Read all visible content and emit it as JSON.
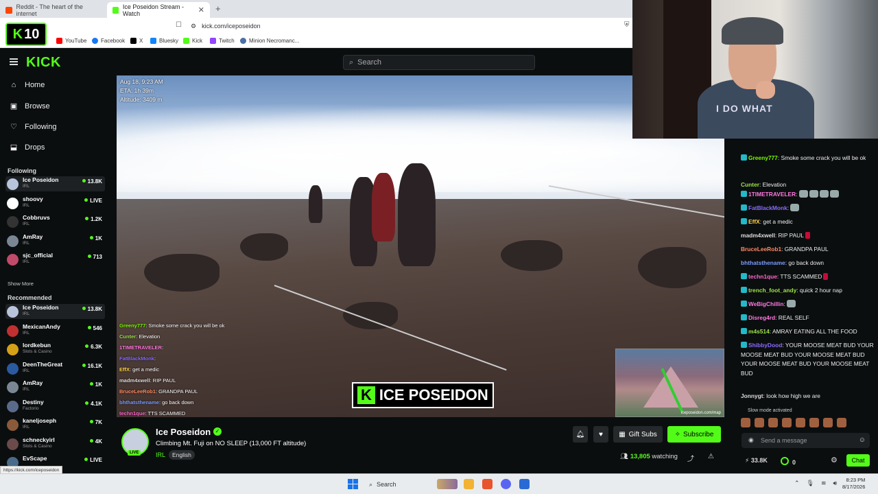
{
  "browser": {
    "tabs": [
      {
        "label": "Reddit - The heart of the internet",
        "color": "#ff4500"
      },
      {
        "label": "Ice Poseidon Stream - Watch",
        "color": "#53fc18"
      }
    ],
    "url": "kick.com/iceposeidon",
    "bookmarks": [
      {
        "label": "YouTube",
        "color": "#ff0000"
      },
      {
        "label": "Facebook",
        "color": "#1877f2"
      },
      {
        "label": "X",
        "color": "#000000"
      },
      {
        "label": "Bluesky",
        "color": "#1185fe"
      },
      {
        "label": "Kick",
        "color": "#53fc18"
      },
      {
        "label": "Twitch",
        "color": "#9146ff"
      },
      {
        "label": "Minion Necromanc...",
        "color": "#4a6fa5"
      }
    ],
    "kick_badge_number": "10",
    "hover_url": "https://kick.com/iceposeidon"
  },
  "kick": {
    "brand": "KICK",
    "search_placeholder": "Search",
    "nav": [
      {
        "label": "Home",
        "icon": "home-icon",
        "glyph": "⌂"
      },
      {
        "label": "Browse",
        "icon": "browse-icon",
        "glyph": "▣"
      },
      {
        "label": "Following",
        "icon": "heart-icon",
        "glyph": "♡"
      },
      {
        "label": "Drops",
        "icon": "drops-icon",
        "glyph": "⬓"
      }
    ],
    "following_title": "Following",
    "following": [
      {
        "name": "Ice Poseidon",
        "cat": "IRL",
        "viewers": "13.8K",
        "color": "#b8c4dc"
      },
      {
        "name": "shoovy",
        "cat": "IRL",
        "viewers": "LIVE",
        "color": "#ffffff"
      },
      {
        "name": "Cobbruvs",
        "cat": "IRL",
        "viewers": "1.2K",
        "color": "#333333"
      },
      {
        "name": "AmRay",
        "cat": "IRL",
        "viewers": "1K",
        "color": "#7a8694"
      },
      {
        "name": "sjc_official",
        "cat": "IRL",
        "viewers": "713",
        "color": "#c04a6a"
      }
    ],
    "show_more": "Show More",
    "recommended_title": "Recommended",
    "recommended": [
      {
        "name": "Ice Poseidon",
        "cat": "IRL",
        "viewers": "13.8K",
        "color": "#b8c4dc"
      },
      {
        "name": "MexicanAndy",
        "cat": "IRL",
        "viewers": "546",
        "color": "#c03030"
      },
      {
        "name": "lordkebun",
        "cat": "Slots & Casino",
        "viewers": "6.3K",
        "color": "#d4a017"
      },
      {
        "name": "DeenTheGreat",
        "cat": "IRL",
        "viewers": "16.1K",
        "color": "#2a5aa0"
      },
      {
        "name": "AmRay",
        "cat": "IRL",
        "viewers": "1K",
        "color": "#7a8694"
      },
      {
        "name": "Destiny",
        "cat": "Factorio",
        "viewers": "4.1K",
        "color": "#5a6a8a"
      },
      {
        "name": "kaneljoseph",
        "cat": "IRL",
        "viewers": "7K",
        "color": "#8a5a3a"
      },
      {
        "name": "schneckyirl",
        "cat": "Slots & Casino",
        "viewers": "4K",
        "color": "#6a4a4a"
      },
      {
        "name": "EvScape",
        "cat": "",
        "viewers": "LIVE",
        "color": "#4a6a8a"
      }
    ]
  },
  "video": {
    "overlay_lines": [
      "Aug 18, 9:23 AM",
      "ETA: 1h 39m",
      "Altitude: 3409 m"
    ],
    "chat_overlay": [
      {
        "user": "Greeny777",
        "color": "#7cfc00",
        "text": " Smoke some crack you will be ok"
      },
      {
        "user": "Cunter",
        "color": "#9ee34a",
        "text": " Elevation"
      },
      {
        "user": "1TIMETRAVELER",
        "color": "#ff79e0",
        "text": ""
      },
      {
        "user": "FatBlackMonk",
        "color": "#8a6cff",
        "text": ""
      },
      {
        "user": "EffX",
        "color": "#ffd54a",
        "text": " get a medic"
      },
      {
        "user": "madm4xwell",
        "color": "#dddddd",
        "text": " RIP PAUL"
      },
      {
        "user": "BruceLeeRob1",
        "color": "#ff8a65",
        "text": " GRANDPA PAUL"
      },
      {
        "user": "bhthatsthename",
        "color": "#7b9cff",
        "text": " go back down"
      },
      {
        "user": "techn1que",
        "color": "#ff66cc",
        "text": " TTS SCAMMED"
      }
    ],
    "stream_logo": "ICE POSEIDON",
    "stream_logo_k": "K",
    "minimap_label": "iceposeidon.com/map"
  },
  "stream": {
    "name": "Ice Poseidon",
    "title": "Climbing Mt. Fuji on NO SLEEP (13,000 FT altitude)",
    "category": "IRL",
    "language": "English",
    "live": "LIVE",
    "gift_subs": "Gift Subs",
    "subscribe": "Subscribe",
    "watching_count": "13,805",
    "watching_label": " watching"
  },
  "webcam": {
    "shirt_text": "I DO WHAT"
  },
  "chat": {
    "messages": [
      {
        "user": "Greeny777",
        "color": "#7cfc00",
        "badge": true,
        "text": " Smoke some crack you will be ok",
        "emotes": 0
      },
      {
        "user": "Cunter",
        "color": "#9ee34a",
        "badge": false,
        "text": " Elevation",
        "emotes": 0
      },
      {
        "user": "1TIMETRAVELER",
        "color": "#ff79e0",
        "badge": true,
        "text": "",
        "emotes": 4
      },
      {
        "user": "FatBlackMonk",
        "color": "#8a6cff",
        "badge": true,
        "text": "",
        "emotes": 1
      },
      {
        "user": "EffX",
        "color": "#ffd54a",
        "badge": true,
        "text": " get a medic",
        "emotes": 0
      },
      {
        "user": "madm4xwell",
        "color": "#dddddd",
        "badge": false,
        "text": " RIP PAUL",
        "emotes": 0
      },
      {
        "user": "BruceLeeRob1",
        "color": "#ff8a65",
        "badge": false,
        "text": " GRANDPA PAUL",
        "emotes": 0
      },
      {
        "user": "bhthatsthename",
        "color": "#7b9cff",
        "badge": false,
        "text": " go back down",
        "emotes": 0
      },
      {
        "user": "techn1que",
        "color": "#ff66cc",
        "badge": true,
        "text": " TTS SCAMMED",
        "emotes": 0
      },
      {
        "user": "trench_foot_andy",
        "color": "#9ee34a",
        "badge": true,
        "text": " quick 2 hour nap",
        "emotes": 0
      },
      {
        "user": "WeBigChillin",
        "color": "#ff79e0",
        "badge": true,
        "text": "",
        "emotes": 1
      },
      {
        "user": "Disreg4rd",
        "color": "#ff79e0",
        "badge": true,
        "text": " REAL SELF",
        "emotes": 0
      },
      {
        "user": "m4s514",
        "color": "#9ee34a",
        "badge": true,
        "text": " AMRAY EATING ALL THE FOOD",
        "emotes": 0
      },
      {
        "user": "ShibbyDood",
        "color": "#8a6cff",
        "badge": true,
        "text": " YOUR MOOSE MEAT BUD YOUR MOOSE MEAT BUD YOUR MOOSE MEAT BUD YOUR MOOSE MEAT BUD YOUR MOOSE MEAT BUD",
        "emotes": 0
      },
      {
        "user": "Jonnygt",
        "color": "#dddddd",
        "badge": false,
        "text": " look how high we are",
        "emotes": 0
      }
    ],
    "slow_mode": "Slow mode activated",
    "input_placeholder": "Send a message",
    "kicks": "33.8K",
    "points": "0",
    "chat_button": "Chat"
  },
  "taskbar": {
    "search": "Search",
    "time": "8:23 PM",
    "date": "8/17/2026"
  }
}
